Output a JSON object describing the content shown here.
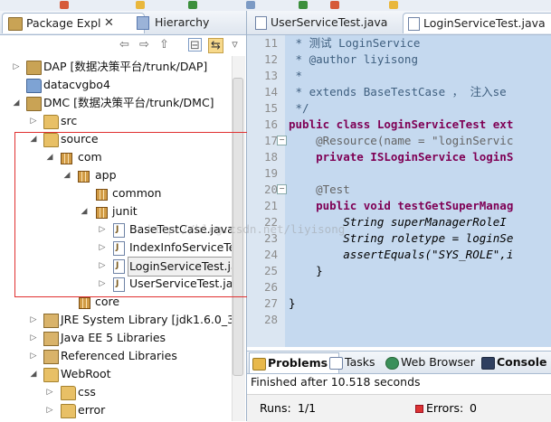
{
  "explorer": {
    "tab_package": "Package Expl",
    "tab_hierarchy": "Hierarchy",
    "close_symbol": "✕",
    "items": [
      {
        "label": "DAP [数据决策平台/trunk/DAP]",
        "icon": "project-icon",
        "expander": "▷"
      },
      {
        "label": "datacvgbo4",
        "icon": "folder-icon",
        "expander": ""
      },
      {
        "label": "DMC [数据决策平台/trunk/DMC]",
        "icon": "project-icon",
        "expander": "◢"
      },
      {
        "label": "src",
        "icon": "source-folder-icon",
        "expander": "▷"
      },
      {
        "label": "source",
        "icon": "source-folder-icon",
        "expander": "◢"
      },
      {
        "label": "com",
        "icon": "package-icon",
        "expander": "◢"
      },
      {
        "label": "app",
        "icon": "package-icon",
        "expander": "◢"
      },
      {
        "label": "common",
        "icon": "package-icon",
        "expander": ""
      },
      {
        "label": "junit",
        "icon": "package-icon",
        "expander": "◢"
      },
      {
        "label": "BaseTestCase.java",
        "icon": "java-file-icon",
        "expander": "▷"
      },
      {
        "label": "IndexInfoServiceTe",
        "icon": "java-file-icon",
        "expander": "▷"
      },
      {
        "label": "LoginServiceTest.ja",
        "icon": "java-file-icon",
        "expander": "▷"
      },
      {
        "label": "UserServiceTest.jav",
        "icon": "java-file-icon",
        "expander": "▷"
      },
      {
        "label": "core",
        "icon": "package-icon",
        "expander": ""
      },
      {
        "label": "JRE System Library [jdk1.6.0_32]",
        "icon": "library-icon",
        "expander": "▷"
      },
      {
        "label": "Java EE 5 Libraries",
        "icon": "library-icon",
        "expander": "▷"
      },
      {
        "label": "Referenced Libraries",
        "icon": "library-icon",
        "expander": "▷"
      },
      {
        "label": "WebRoot",
        "icon": "folder-icon",
        "expander": "◢"
      },
      {
        "label": "css",
        "icon": "folder-icon",
        "expander": "▷"
      },
      {
        "label": "error",
        "icon": "folder-icon",
        "expander": "▷"
      }
    ]
  },
  "editor": {
    "tab_user": "UserServiceTest.java",
    "tab_login": "LoginServiceTest.java",
    "line_numbers": [
      "11",
      "12",
      "13",
      "14",
      "15",
      "16",
      "17",
      "18",
      "19",
      "20",
      "21",
      "22",
      "23",
      "24",
      "25",
      "26",
      "27",
      "28"
    ],
    "lines": [
      " * 测试 LoginService",
      " * @author liyisong",
      " *",
      " * extends BaseTestCase ， 注入se",
      " */",
      "public class LoginServiceTest ext",
      "    @Resource(name = \"loginServic",
      "    private ISLoginService loginS",
      "",
      "    @Test",
      "    public void testGetSuperManag",
      "        String superManagerRoleI",
      "        String roletype = loginSe",
      "        assertEquals(\"SYS_ROLE\",i",
      "    }",
      "",
      "}",
      ""
    ],
    "watermark": "http://blog.csdn.net/liyisong"
  },
  "bottom": {
    "tab_problems": "Problems",
    "tab_tasks": "Tasks",
    "tab_web": "Web Browser",
    "tab_console": "Console",
    "status": "Finished after 10.518 seconds",
    "runs_label": "Runs:",
    "runs_value": "1/1",
    "errors_label": "Errors:",
    "errors_value": "0"
  }
}
